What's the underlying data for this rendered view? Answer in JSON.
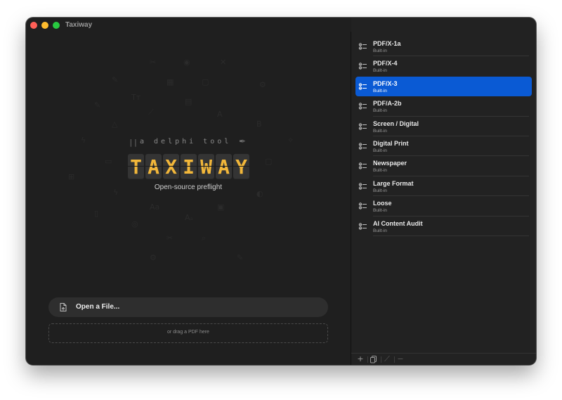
{
  "window": {
    "title": "Taxiway"
  },
  "brand": {
    "tagline": "a delphi tool",
    "flap_letters": [
      "T",
      "A",
      "X",
      "I",
      "W",
      "A",
      "Y"
    ],
    "subtitle": "Open-source preflight"
  },
  "actions": {
    "open_label": "Open a File...",
    "drop_hint": "or drag a PDF here"
  },
  "presets": [
    {
      "name": "PDF/X-1a",
      "subtitle": "Built-in",
      "selected": false
    },
    {
      "name": "PDF/X-4",
      "subtitle": "Built-in",
      "selected": false
    },
    {
      "name": "PDF/X-3",
      "subtitle": "Built-in",
      "selected": true
    },
    {
      "name": "PDF/A-2b",
      "subtitle": "Built-in",
      "selected": false
    },
    {
      "name": "Screen / Digital",
      "subtitle": "Built-in",
      "selected": false
    },
    {
      "name": "Digital Print",
      "subtitle": "Built-in",
      "selected": false
    },
    {
      "name": "Newspaper",
      "subtitle": "Built-in",
      "selected": false
    },
    {
      "name": "Large Format",
      "subtitle": "Built-in",
      "selected": false
    },
    {
      "name": "Loose",
      "subtitle": "Built-in",
      "selected": false
    },
    {
      "name": "AI Content Audit",
      "subtitle": "Built-in",
      "selected": false
    }
  ],
  "toolbar": {
    "add_icon": "plus-icon",
    "duplicate_icon": "duplicate-icon",
    "edit_icon": "pencil-icon",
    "remove_icon": "minus-icon"
  },
  "colors": {
    "accent": "#0a5ad4",
    "flap_text": "#f2b73a",
    "background": "#1f1f1f",
    "sidebar": "#222222"
  }
}
